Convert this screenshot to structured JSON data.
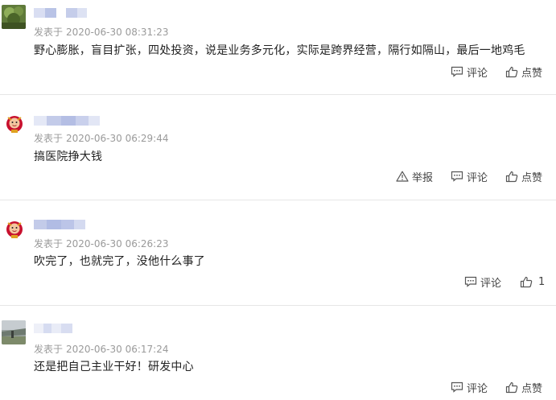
{
  "labels": {
    "published_prefix": "发表于",
    "reply": "评论",
    "like": "点赞",
    "report": "举报"
  },
  "comments": [
    {
      "date": "2020-06-30",
      "time": "08:31:23",
      "text": "野心膨胀，盲目扩张，四处投资，说是业务多元化，实际是跨界经营，隔行如隔山，最后一地鸡毛",
      "like_text": "点赞"
    },
    {
      "date": "2020-06-30",
      "time": "06:29:44",
      "text": "搞医院挣大钱",
      "like_text": "点赞"
    },
    {
      "date": "2020-06-30",
      "time": "06:26:23",
      "text": "吹完了，也就完了，没他什么事了",
      "like_text": "1"
    },
    {
      "date": "2020-06-30",
      "time": "06:17:24",
      "text": "还是把自己主业干好！研发中心",
      "like_text": "点赞"
    }
  ],
  "colors": {
    "username_blur": "#b9c3e6",
    "meta_gray": "#9a9a9a",
    "divider": "#e6e6e6"
  }
}
